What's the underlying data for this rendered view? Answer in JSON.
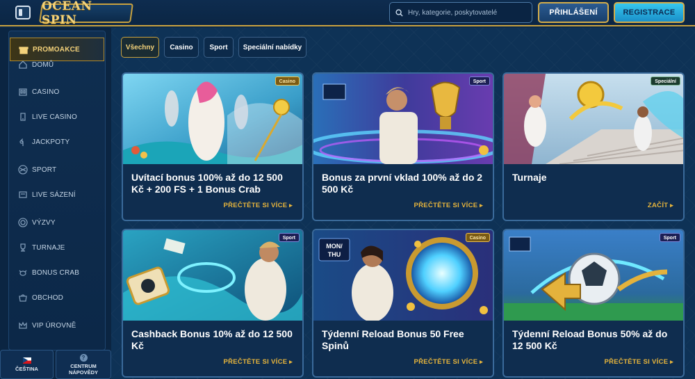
{
  "header": {
    "logo_text": "OCEAN SPIN",
    "search_placeholder": "Hry, kategorie, poskytovatelé",
    "login_label": "PŘIHLÁŠENÍ",
    "register_label": "REGISTRACE"
  },
  "sidebar": {
    "items": [
      {
        "label": "PROMOAKCE",
        "icon": "gift-icon"
      },
      {
        "label": "DOMŮ",
        "icon": "home-icon"
      },
      {
        "label": "CASINO",
        "icon": "slot-icon"
      },
      {
        "label": "LIVE CASINO",
        "icon": "live-casino-icon"
      },
      {
        "label": "JACKPOTY",
        "icon": "clover-icon"
      },
      {
        "label": "SPORT",
        "icon": "ball-icon"
      },
      {
        "label": "LIVE SÁZENÍ",
        "icon": "live-betting-icon"
      },
      {
        "label": "VÝZVY",
        "icon": "target-icon"
      },
      {
        "label": "TURNAJE",
        "icon": "trophy-icon"
      },
      {
        "label": "BONUS CRAB",
        "icon": "crab-icon"
      },
      {
        "label": "OBCHOD",
        "icon": "shop-icon"
      },
      {
        "label": "VIP ÚROVNĚ",
        "icon": "crown-icon"
      }
    ],
    "language_label": "ČEŠTINA",
    "help_label_1": "CENTRUM",
    "help_label_2": "NÁPOVĚDY"
  },
  "filters": [
    "Všechny",
    "Casino",
    "Sport",
    "Speciální nabídky"
  ],
  "cards": [
    {
      "badge": "Casino",
      "title": "Uvítací bonus 100% až do 12 500 Kč + 200 FS + 1 Bonus Crab",
      "cta": "PŘEČTĚTE SI VÍCE"
    },
    {
      "badge": "Sport",
      "title": "Bonus za první vklad 100% až do 2 500 Kč",
      "cta": "PŘEČTĚTE SI VÍCE"
    },
    {
      "badge": "Speciální",
      "title": "Turnaje",
      "cta": "ZAČÍT"
    },
    {
      "badge": "Sport",
      "title": "Cashback Bonus 10% až do 12 500 Kč",
      "cta": "PŘEČTĚTE SI VÍCE"
    },
    {
      "badge": "Casino",
      "title": "Týdenní Reload Bonus 50 Free Spinů",
      "cta": "PŘEČTĚTE SI VÍCE"
    },
    {
      "badge": "Sport",
      "title": "Týdenní Reload Bonus 50% až do 12 500 Kč",
      "cta": "PŘEČTĚTE SI VÍCE"
    }
  ],
  "card5_banner": "MON/THU",
  "colors": {
    "accent_gold": "#c9a23f",
    "cta_gold": "#e7b53c",
    "bg_navy": "#0e3256",
    "register_cyan": "#36c7ee"
  }
}
